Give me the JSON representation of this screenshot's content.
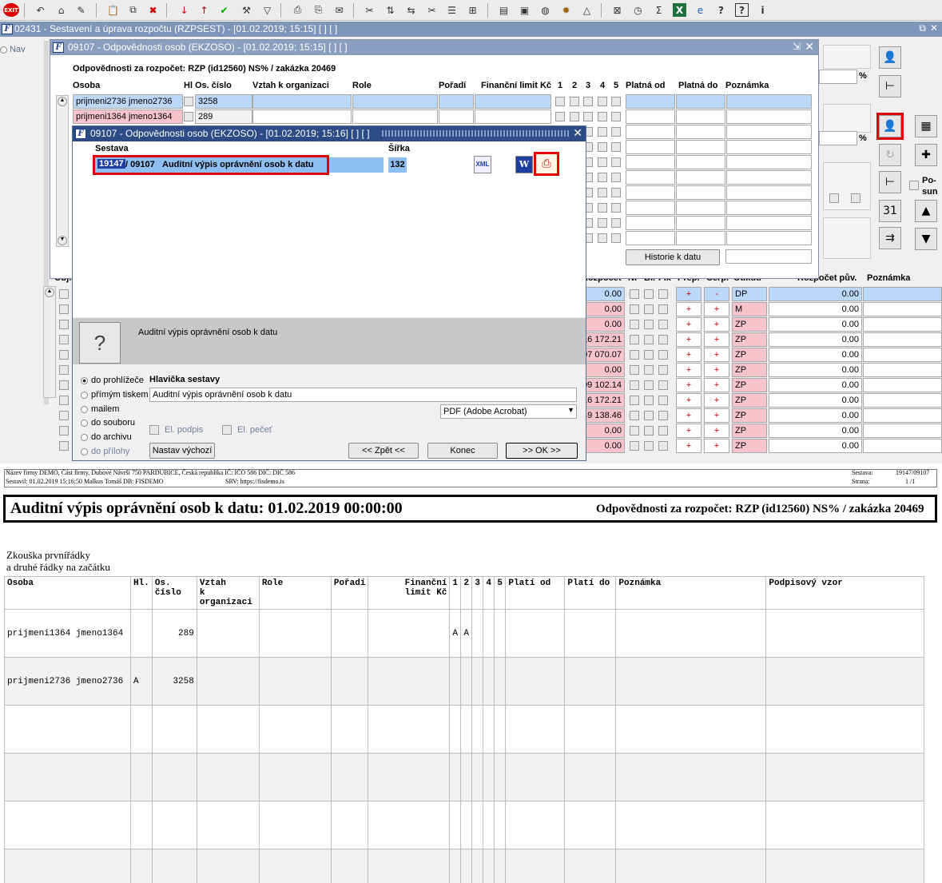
{
  "toolbar": {
    "icons": [
      "exit-icon",
      "undo-icon",
      "home-icon",
      "tool-icon",
      "paste-icon",
      "copy-icon",
      "delete-icon",
      "sort-asc-icon",
      "sort-desc-icon",
      "check-icon",
      "wrench-icon",
      "filter-icon",
      "print-icon",
      "print-preview-icon",
      "mail-icon",
      "cut-icon",
      "split-icon",
      "merge-icon",
      "list-icon",
      "tree-icon",
      "document-icon",
      "save-icon",
      "globe-icon",
      "settings-icon",
      "chart-icon",
      "report-icon",
      "clock-icon",
      "sum-icon",
      "excel-icon",
      "ie-icon",
      "help-icon",
      "help2-icon",
      "info-icon"
    ],
    "exit_label": "EXIT"
  },
  "app_window": {
    "title": "02431 - Sestavení a úprava rozpočtu (RZPSEST) - [01.02.2019; 15:15]  [ ]  [ ]",
    "nav_label": "Nav"
  },
  "dialog1": {
    "title": "09107 - Odpovědnosti osob (EKZOSO) - [01.02.2019; 15:15]  [ ]  [ ]",
    "heading": "Odpovědnosti za rozpočet: RZP (id12560) NS% / zakázka 20469",
    "columns": [
      "Osoba",
      "Hl",
      "Os. číslo",
      "Vztah k organizaci",
      "Role",
      "Pořadí",
      "Finanční limit Kč",
      "1",
      "2",
      "3",
      "4",
      "5",
      "Platná od",
      "Platná do",
      "Poznámka"
    ],
    "rows": [
      {
        "osoba": "prijmeni2736 jmeno2736",
        "cislo": "3258"
      },
      {
        "osoba": "prijmeni1364 jmeno1364",
        "cislo": "289"
      }
    ],
    "history_button": "Historie k datu"
  },
  "lower_grid": {
    "headers": {
      "obj": "Obj.",
      "rozpocet": "Rozpočet",
      "np": "NP",
      "bl": "Bl.",
      "fix": "Fix",
      "prep": "Přep.",
      "cerp": "Čerp.",
      "odkud": "Odkud",
      "rozpocet_puv": "Rozpočet pův.",
      "poznamka": "Poznámka"
    },
    "rows": [
      {
        "amount": "0.00",
        "p1": "+",
        "p2": "-",
        "code": "DP",
        "orig": "0.00",
        "blue": true
      },
      {
        "amount": "0.00",
        "p1": "+",
        "p2": "+",
        "code": "M",
        "orig": "0.00",
        "blue": false
      },
      {
        "amount": "0.00",
        "p1": "+",
        "p2": "+",
        "code": "ZP",
        "orig": "0.00",
        "blue": false
      },
      {
        "amount": "16 172.21",
        "p1": "+",
        "p2": "+",
        "code": "ZP",
        "orig": "0.00",
        "blue": false
      },
      {
        "amount": "07 070.07",
        "p1": "+",
        "p2": "+",
        "code": "ZP",
        "orig": "0.00",
        "blue": false
      },
      {
        "amount": "0.00",
        "p1": "+",
        "p2": "+",
        "code": "ZP",
        "orig": "0.00",
        "blue": false
      },
      {
        "amount": "09 102.14",
        "p1": "+",
        "p2": "+",
        "code": "ZP",
        "orig": "0.00",
        "blue": false
      },
      {
        "amount": "16 172.21",
        "p1": "+",
        "p2": "+",
        "code": "ZP",
        "orig": "0.00",
        "blue": false
      },
      {
        "amount": "49 138.46",
        "p1": "+",
        "p2": "+",
        "code": "ZP",
        "orig": "0.00",
        "blue": false
      },
      {
        "amount": "0.00",
        "p1": "+",
        "p2": "+",
        "code": "ZP",
        "orig": "0.00",
        "blue": false
      },
      {
        "amount": "0.00",
        "p1": "+",
        "p2": "+",
        "code": "ZP",
        "orig": "0.00",
        "blue": false
      }
    ]
  },
  "right_panel": {
    "percent": "%",
    "posun": "Po-\nsun"
  },
  "dialog2": {
    "title": "09107 - Odpovědnosti osob (EKZOSO) - [01.02.2019; 15:16]  [ ]  [ ]",
    "col_sestava": "Sestava",
    "col_sirka": "Šířka",
    "selected_report": {
      "id": "19147",
      "module": "/ 09107",
      "name": "Auditní výpis oprávnění osob k datu",
      "width": "132"
    },
    "export_icons": [
      "xml-export-icon",
      "word-export-icon",
      "pdf-export-icon"
    ],
    "description": "Auditní výpis oprávnění osob k datu",
    "output_options": [
      "do prohlížeče",
      "přímým tiskem",
      "mailem",
      "do souboru",
      "do archivu",
      "do přílohy"
    ],
    "selected_output": "do prohlížeče",
    "header_label": "Hlavička sestavy",
    "header_value": "Auditní výpis oprávnění osob k datu",
    "format": "PDF (Adobe Acrobat)",
    "el_podpis": "El. podpis",
    "el_pecet": "El. pečeť",
    "buttons": {
      "nastav": "Nastav výchozí",
      "zpet": "<< Zpět <<",
      "konec": "Konec",
      "ok": ">> OK >>"
    }
  },
  "report": {
    "company_line": "Název firmy DEMO, Část firmy, Dubové Návrší 750 PARDUBICE, Česká republika  IČ: IČO 586  DIČ: DIČ 586",
    "author_line": "Sestavil: 01.02.2019 15:16:50 Malkus Tomáš  DB: FISDEMO",
    "srv_line": "SRV: https://fisdemo.is",
    "sestava_label": "Sestava:",
    "sestava_value": "19147/09107",
    "strana_label": "Strana:",
    "strana_value": "1  /1",
    "title": "Auditní výpis oprávnění osob k datu: 01.02.2019 00:00:00",
    "subtitle": "Odpovědnosti za rozpočet: RZP (id12560) NS% / zakázka 20469",
    "note_line1": "Zkouška prvnířádky",
    "note_line2": "a druhé řádky na začátku",
    "columns": [
      "Osoba",
      "Hl.",
      "Os. číslo",
      "Vztah\nk organizaci",
      "Role",
      "Pořadí",
      "Finanční\nlimit Kč",
      "1",
      "2",
      "3",
      "4",
      "5",
      "Platí od",
      "Platí do",
      "Poznámka",
      "Podpisový vzor"
    ],
    "rows": [
      [
        "prijmeni1364 jmeno1364",
        "",
        "289",
        "",
        "",
        "",
        "",
        "A",
        "A",
        "",
        "",
        "",
        "",
        "",
        "",
        ""
      ],
      [
        "prijmeni2736 jmeno2736",
        "A",
        "3258",
        "",
        "",
        "",
        "",
        "",
        "",
        "",
        "",
        "",
        "",
        "",
        "",
        ""
      ],
      [
        "",
        "",
        "",
        "",
        "",
        "",
        "",
        "",
        "",
        "",
        "",
        "",
        "",
        "",
        "",
        ""
      ],
      [
        "",
        "",
        "",
        "",
        "",
        "",
        "",
        "",
        "",
        "",
        "",
        "",
        "",
        "",
        "",
        ""
      ],
      [
        "",
        "",
        "",
        "",
        "",
        "",
        "",
        "",
        "",
        "",
        "",
        "",
        "",
        "",
        "",
        ""
      ],
      [
        "",
        "",
        "",
        "",
        "",
        "",
        "",
        "",
        "",
        "",
        "",
        "",
        "",
        "",
        "",
        ""
      ]
    ]
  }
}
